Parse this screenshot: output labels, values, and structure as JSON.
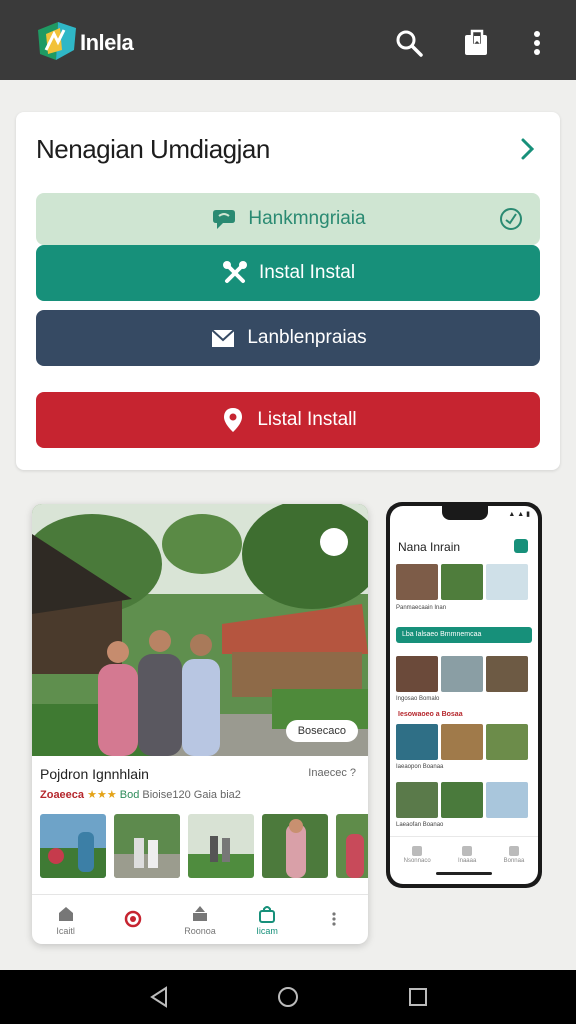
{
  "app": {
    "brand": "Inlela",
    "colors": {
      "appbar": "#3a3a3a",
      "accent": "#17907a",
      "navy": "#364a63",
      "danger": "#c62430",
      "mint": "#cfe5d2"
    },
    "icons": [
      "search-icon",
      "bookmark-icon",
      "more-vert-icon"
    ]
  },
  "card": {
    "title": "Nenagian Umdiagjan",
    "buttons": [
      {
        "label": "Hankmngriaia",
        "icon": "chat-bubble-icon",
        "status_icon": "check-circle-icon"
      },
      {
        "label": "Instal Instal",
        "icon": "tools-icon"
      },
      {
        "label": "Lanblenpraias",
        "icon": "envelope-icon"
      },
      {
        "label": "Listal Install",
        "icon": "location-pin-icon"
      }
    ]
  },
  "tablet": {
    "hero_chip": "Bosecaco",
    "place_title": "Pojdron Ignnhlain",
    "place_meta": "Inaecec ?",
    "rating_prefix": "Zoaeeca",
    "rating_stars": "★★★",
    "rating_green": "Bod",
    "rating_middle": "Bioise120",
    "rating_suffix": "Gaia bia2",
    "thumb_chip": "♦ ♦ ♦",
    "nav": [
      {
        "label": "Icaitl",
        "icon": "home-icon"
      },
      {
        "label": "",
        "icon": "gallery-icon"
      },
      {
        "label": "Roonoa",
        "icon": "upload-icon"
      },
      {
        "label": "Iicam",
        "icon": "bag-icon",
        "active": true
      },
      {
        "label": "",
        "icon": "more-icon"
      }
    ]
  },
  "phone": {
    "status": "▲ ▲ ▮",
    "title": "Nana Inrain",
    "captions_row1": "Panmaecaain  Inan",
    "banner": "Lba Ialsaeo Bmmnemcaa",
    "captions_row2": "Ingosao  Bomalo",
    "red_label": "Iesowaoeo a Bosaa",
    "captions_row3": "Iaeaopon  Boanaa",
    "captions_row4": "Laeaofan  Boanao",
    "nav": [
      "Nsonnaco",
      "Inaaaa",
      "Bonnaa"
    ]
  }
}
